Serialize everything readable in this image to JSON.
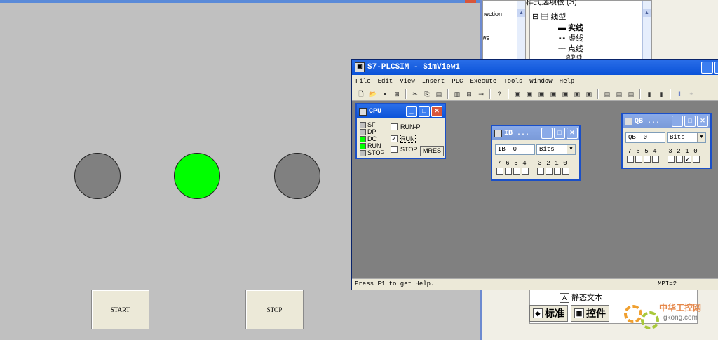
{
  "hmi": {
    "lamps": [
      {
        "name": "lamp-left",
        "color": "#808080"
      },
      {
        "name": "lamp-middle",
        "color": "#00ff00"
      },
      {
        "name": "lamp-right",
        "color": "#808080"
      }
    ],
    "start_label": "START",
    "stop_label": "STOP"
  },
  "bg": {
    "panel1_line1": "nection",
    "panel1_line2": "ws",
    "panel2_title": "样式选项板 (S)",
    "tree_root": "线型",
    "tree_items": [
      "实线",
      "虚线",
      "点线",
      "点划线"
    ],
    "panel3_item": "静态文本",
    "tab_standard": "标准",
    "tab_controls": "控件",
    "watermark_text": "中华工控网",
    "watermark_domain": "gkong.com"
  },
  "simwin": {
    "title": "S7-PLCSIM - SimView1",
    "menu": [
      "File",
      "Edit",
      "View",
      "Insert",
      "PLC",
      "Execute",
      "Tools",
      "Window",
      "Help"
    ],
    "status_left": "Press F1 to get Help.",
    "status_right": "MPI=2"
  },
  "cpu": {
    "title": "CPU",
    "leds": [
      {
        "label": "SF",
        "on": false
      },
      {
        "label": "DP",
        "on": false
      },
      {
        "label": "DC",
        "on": true
      },
      {
        "label": "RUN",
        "on": true
      },
      {
        "label": "STOP",
        "on": false
      }
    ],
    "modes": [
      {
        "label": "RUN-P",
        "checked": false
      },
      {
        "label": "RUN",
        "checked": true
      },
      {
        "label": "STOP",
        "checked": false
      }
    ],
    "mres_label": "MRES"
  },
  "ib": {
    "title": "IB ...",
    "address_prefix": "IB",
    "address_value": "0",
    "format": "Bits",
    "bit_labels": [
      "7",
      "6",
      "5",
      "4",
      "3",
      "2",
      "1",
      "0"
    ],
    "bits": [
      false,
      false,
      false,
      false,
      false,
      false,
      false,
      false
    ]
  },
  "qb": {
    "title": "QB ...",
    "address_prefix": "QB",
    "address_value": "0",
    "format": "Bits",
    "bit_labels": [
      "7",
      "6",
      "5",
      "4",
      "3",
      "2",
      "1",
      "0"
    ],
    "bits": [
      false,
      false,
      false,
      false,
      false,
      false,
      true,
      false
    ]
  }
}
